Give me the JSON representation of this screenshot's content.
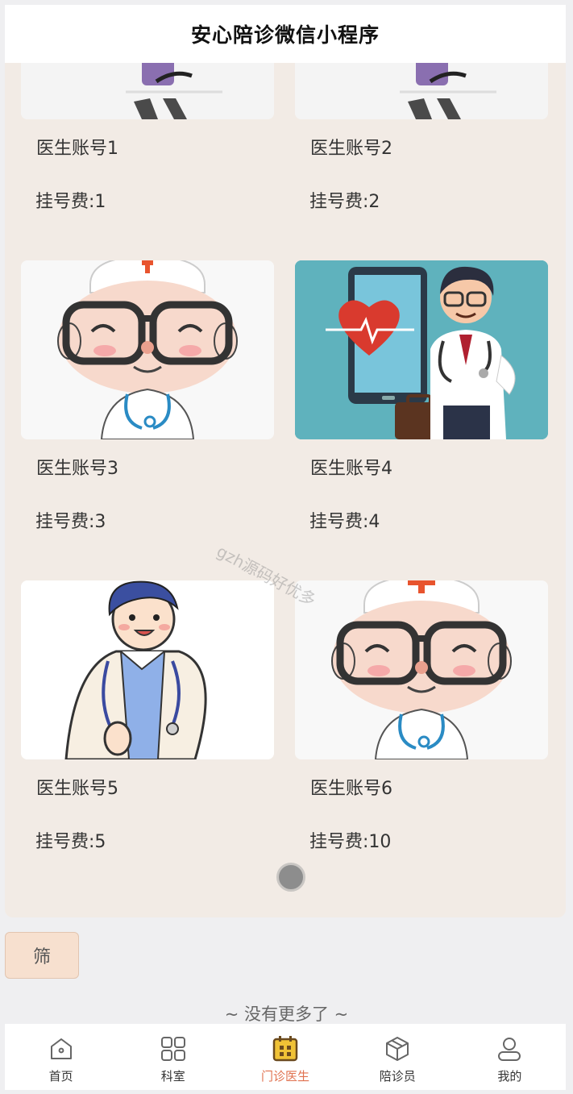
{
  "header": {
    "title": "安心陪诊微信小程序"
  },
  "doctors": [
    {
      "name": "医生账号1",
      "fee": "挂号费:1"
    },
    {
      "name": "医生账号2",
      "fee": "挂号费:2"
    },
    {
      "name": "医生账号3",
      "fee": "挂号费:3"
    },
    {
      "name": "医生账号4",
      "fee": "挂号费:4"
    },
    {
      "name": "医生账号5",
      "fee": "挂号费:5"
    },
    {
      "name": "医生账号6",
      "fee": "挂号费:10"
    }
  ],
  "watermark": "gzh源码好优多",
  "filter_label": "筛",
  "no_more_text": "~ 没有更多了 ~",
  "tabbar": {
    "items": [
      {
        "label": "首页",
        "icon": "home-icon"
      },
      {
        "label": "科室",
        "icon": "grid-icon"
      },
      {
        "label": "门诊医生",
        "icon": "calendar-icon",
        "active": true
      },
      {
        "label": "陪诊员",
        "icon": "cube-icon"
      },
      {
        "label": "我的",
        "icon": "user-icon"
      }
    ]
  },
  "colors": {
    "accent": "#e0714f",
    "panel": "#f2ebe5",
    "filter": "#f7e0cf"
  }
}
